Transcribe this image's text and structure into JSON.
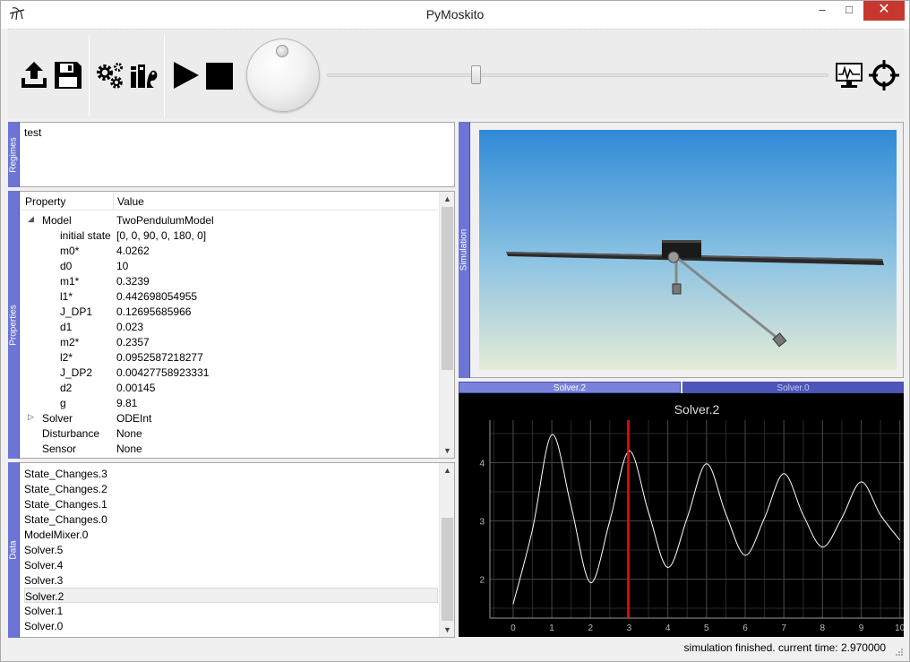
{
  "window": {
    "title": "PyMoskito",
    "controls": {
      "minimize": "–",
      "maximize": "□",
      "close": "✕"
    }
  },
  "toolbar": {
    "items": [
      {
        "name": "upload-icon",
        "icon": "upload-icon"
      },
      {
        "name": "save-icon",
        "icon": "floppy-disk-icon"
      },
      {
        "name": "settings-icon",
        "icon": "gears-icon"
      },
      {
        "name": "postprocessing-icon",
        "icon": "postprocessing-icon"
      },
      {
        "name": "play-icon",
        "icon": "play-icon"
      },
      {
        "name": "stop-icon",
        "icon": "stop-icon"
      },
      {
        "name": "plot-icon",
        "icon": "monitor-chart-icon"
      },
      {
        "name": "reset-camera-icon",
        "icon": "crosshair-icon"
      }
    ],
    "time_slider_position": 0.297
  },
  "docks": {
    "regimes": "Regimes",
    "properties": "Properties",
    "data": "Data",
    "simulation": "Simulation"
  },
  "regimes": {
    "items": [
      "test"
    ]
  },
  "properties": {
    "headers": {
      "property": "Property",
      "value": "Value"
    },
    "rows": [
      {
        "key": "Model",
        "value": "TwoPendulumModel",
        "level": 0,
        "expander": "◢"
      },
      {
        "key": "initial state",
        "value": "[0, 0, 90, 0, 180, 0]",
        "level": 1
      },
      {
        "key": "m0*",
        "value": "4.0262",
        "level": 1
      },
      {
        "key": "d0",
        "value": "10",
        "level": 1
      },
      {
        "key": "m1*",
        "value": "0.3239",
        "level": 1
      },
      {
        "key": "l1*",
        "value": "0.442698054955",
        "level": 1
      },
      {
        "key": "J_DP1",
        "value": "0.12695685966",
        "level": 1
      },
      {
        "key": "d1",
        "value": "0.023",
        "level": 1
      },
      {
        "key": "m2*",
        "value": "0.2357",
        "level": 1
      },
      {
        "key": "l2*",
        "value": "0.0952587218277",
        "level": 1
      },
      {
        "key": "J_DP2",
        "value": "0.00427758923331",
        "level": 1
      },
      {
        "key": "d2",
        "value": "0.00145",
        "level": 1
      },
      {
        "key": "g",
        "value": "9.81",
        "level": 1
      },
      {
        "key": "Solver",
        "value": "ODEInt",
        "level": 0,
        "expander": "▷"
      },
      {
        "key": "Disturbance",
        "value": "None",
        "level": 0
      },
      {
        "key": "Sensor",
        "value": "None",
        "level": 0
      }
    ]
  },
  "data": {
    "items": [
      "State_Changes.3",
      "State_Changes.2",
      "State_Changes.1",
      "State_Changes.0",
      "ModelMixer.0",
      "Solver.5",
      "Solver.4",
      "Solver.3",
      "Solver.2",
      "Solver.1",
      "Solver.0"
    ],
    "selected": "Solver.2"
  },
  "plot_tabs": [
    "Solver.2",
    "Solver.0"
  ],
  "plot": {
    "title": "Solver.2"
  },
  "chart_data": {
    "type": "line",
    "title": "Solver.2",
    "xlabel": "",
    "ylabel": "",
    "xlim": [
      -0.6,
      10.1
    ],
    "ylim": [
      1.33,
      4.73
    ],
    "xticks": [
      0,
      1,
      2,
      3,
      4,
      5,
      6,
      7,
      8,
      9,
      10
    ],
    "yticks": [
      2,
      3,
      4
    ],
    "grid": true,
    "series": [
      {
        "x": [
          0,
          0.5,
          1,
          1.5,
          2,
          2.5,
          3,
          3.5,
          4,
          4.5,
          5,
          5.5,
          6,
          6.5,
          7,
          7.5,
          8,
          8.5,
          9,
          9.5,
          10
        ],
        "y": [
          1.57,
          2.85,
          4.48,
          3.25,
          1.94,
          3.0,
          4.2,
          3.15,
          2.2,
          3.05,
          3.98,
          3.12,
          2.41,
          3.05,
          3.81,
          3.1,
          2.55,
          3.05,
          3.67,
          3.1,
          2.67
        ]
      }
    ],
    "marker_line_x": 2.97,
    "line_color": "#ffffff",
    "marker_color": "#ff0000",
    "background": "#000000"
  },
  "status": {
    "text": "simulation finished.  current time: 2.970000"
  }
}
